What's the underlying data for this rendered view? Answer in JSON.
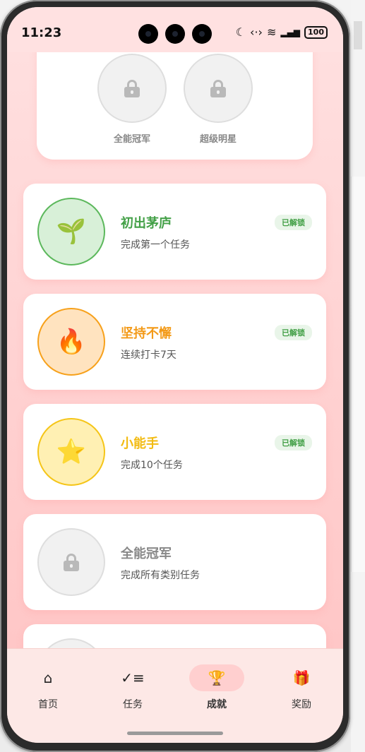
{
  "status_bar": {
    "time": "11:23",
    "battery": "100"
  },
  "top_card": {
    "badges": [
      {
        "label": "全能冠军"
      },
      {
        "label": "超级明星"
      }
    ]
  },
  "achievements": [
    {
      "title": "初出茅庐",
      "desc": "完成第一个任务",
      "tag": "已解锁",
      "icon": "sprout-icon",
      "emoji": "🌱",
      "color": "#43a047",
      "bg": "#d8f0d8",
      "border": "#5cb85c"
    },
    {
      "title": "坚持不懈",
      "desc": "连续打卡7天",
      "tag": "已解锁",
      "icon": "fire-icon",
      "emoji": "🔥",
      "color": "#f39a18",
      "bg": "#ffe3bf",
      "border": "#f7a11b"
    },
    {
      "title": "小能手",
      "desc": "完成10个任务",
      "tag": "已解锁",
      "icon": "star-icon",
      "emoji": "⭐",
      "color": "#f2bb12",
      "bg": "#fff0b3",
      "border": "#f5c518"
    },
    {
      "title": "全能冠军",
      "desc": "完成所有类别任务",
      "tag": "",
      "icon": "lock-icon",
      "color": "#888888",
      "bg": "#f1f1f1",
      "border": "#dedede"
    }
  ],
  "tabs": [
    {
      "label": "首页",
      "icon": "home-icon"
    },
    {
      "label": "任务",
      "icon": "checklist-icon"
    },
    {
      "label": "成就",
      "icon": "trophy-icon",
      "active": true
    },
    {
      "label": "奖励",
      "icon": "gift-icon"
    }
  ]
}
